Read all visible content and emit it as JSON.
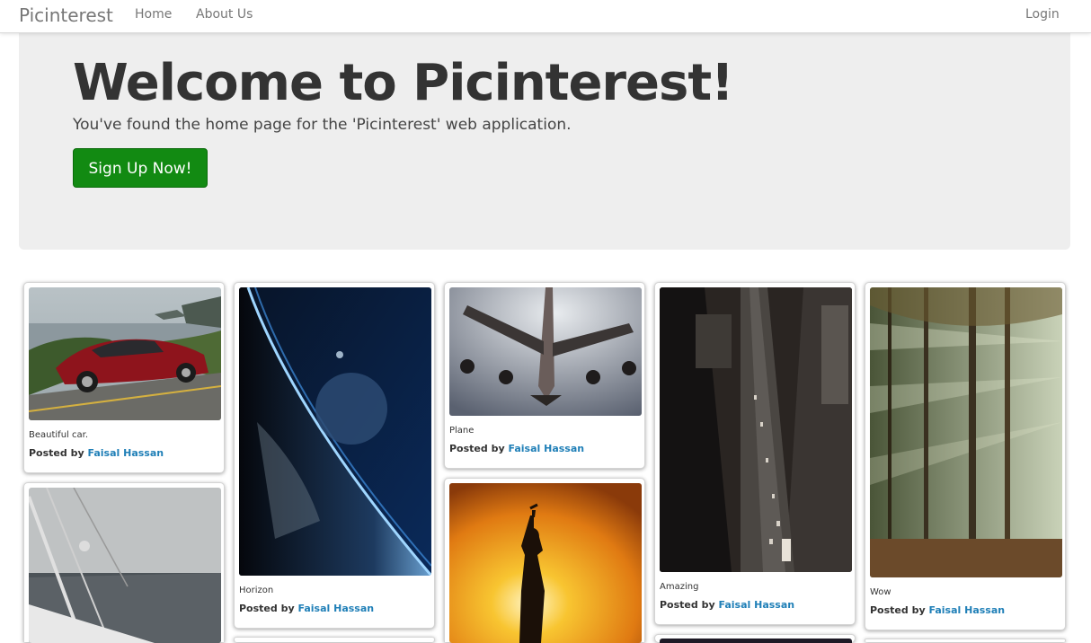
{
  "navbar": {
    "brand": "Picinterest",
    "links": {
      "home": "Home",
      "about": "About Us",
      "login": "Login"
    }
  },
  "hero": {
    "title": "Welcome to Picinterest!",
    "subtitle": "You've found the home page for the 'Picinterest' web application.",
    "button": "Sign Up Now!"
  },
  "posted_by_label": "Posted by",
  "pins": [
    {
      "caption": "Beautiful car.",
      "author": "Faisal Hassan",
      "image": "red-car"
    },
    {
      "caption": "Horizon",
      "author": "Faisal Hassan",
      "image": "planet-horizon"
    },
    {
      "caption": "Plane",
      "author": "Faisal Hassan",
      "image": "airplane"
    },
    {
      "caption": "Amazing",
      "author": "Faisal Hassan",
      "image": "city-street"
    },
    {
      "caption": "Wow",
      "author": "Faisal Hassan",
      "image": "forest-sunrays"
    },
    {
      "caption": "",
      "author": "",
      "image": "sailboat"
    },
    {
      "caption": "",
      "author": "",
      "image": "statue-of-liberty-sunset"
    }
  ],
  "colors": {
    "accent_green": "#128a12",
    "link_blue": "#1f7fb7",
    "hero_bg": "#eeeeee"
  }
}
